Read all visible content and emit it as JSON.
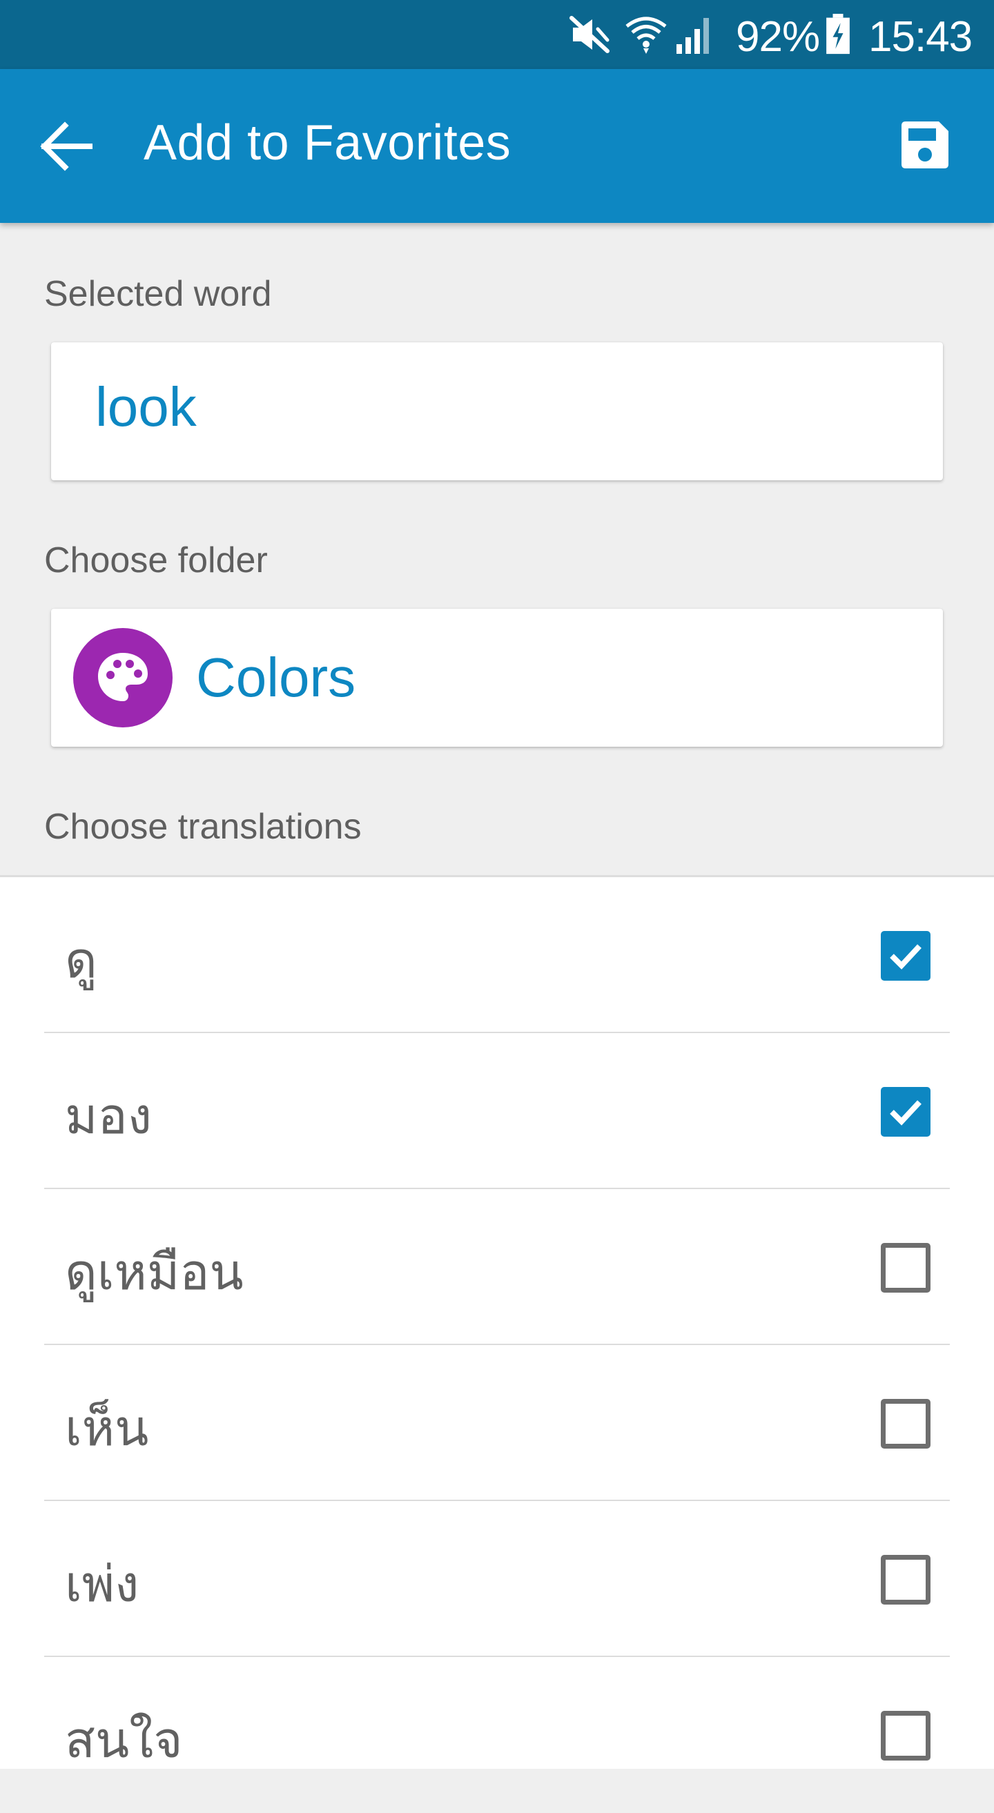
{
  "status_bar": {
    "icons": [
      "mute-icon",
      "wifi-icon",
      "signal-icon",
      "battery-charging-icon"
    ],
    "battery_percent": "92%",
    "time": "15:43"
  },
  "app_bar": {
    "title": "Add to Favorites",
    "back_icon": "arrow-back-icon",
    "save_icon": "save-icon"
  },
  "selected_word": {
    "label": "Selected word",
    "value": "look"
  },
  "folder": {
    "label": "Choose folder",
    "name": "Colors",
    "icon": "palette-icon",
    "icon_color": "#9c27b0"
  },
  "translations": {
    "label": "Choose translations",
    "items": [
      {
        "text": "ดู",
        "checked": true
      },
      {
        "text": "มอง",
        "checked": true
      },
      {
        "text": "ดูเหมือน",
        "checked": false
      },
      {
        "text": "เห็น",
        "checked": false
      },
      {
        "text": "เพ่ง",
        "checked": false
      },
      {
        "text": "สนใจ",
        "checked": false
      }
    ]
  },
  "colors": {
    "status_bar": "#0b678f",
    "app_bar": "#0d87c2",
    "accent": "#0d87c2",
    "background": "#efefef"
  }
}
